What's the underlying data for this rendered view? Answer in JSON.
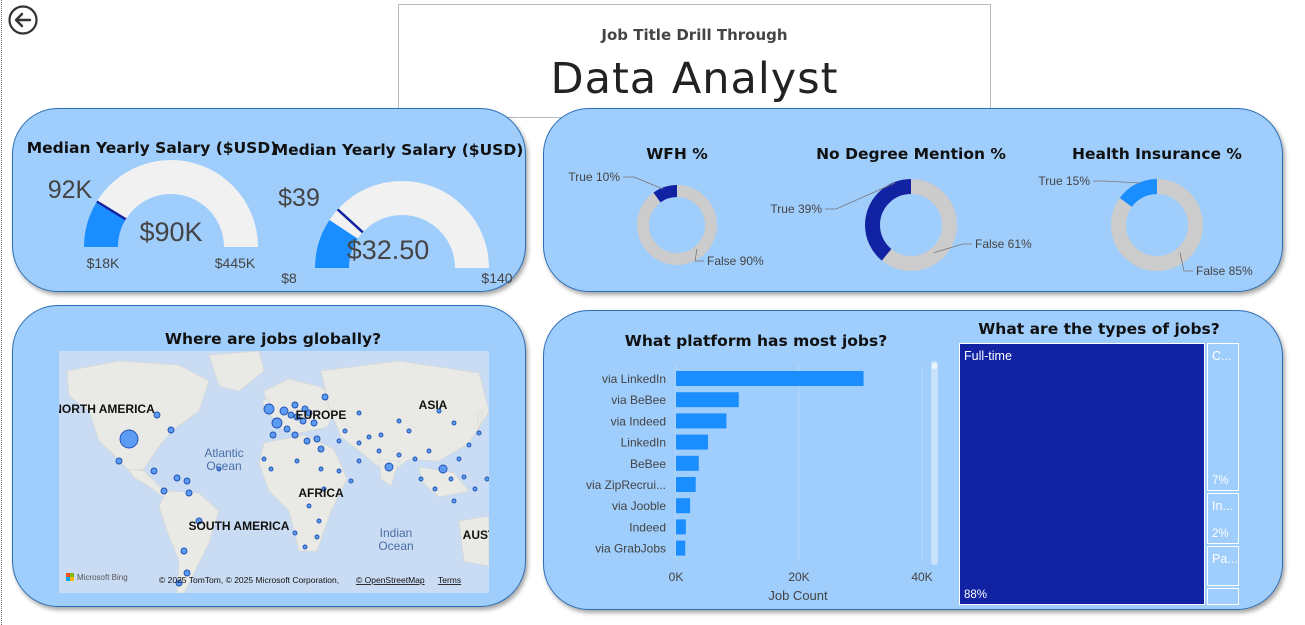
{
  "header": {
    "subtitle": "Job Title Drill Through",
    "title": "Data Analyst"
  },
  "salary_gauges": [
    {
      "title": "Median Yearly Salary ($USD)",
      "value": "$90K",
      "target": "92K",
      "min": "$18K",
      "max": "$445K",
      "fill_fraction": 0.17,
      "target_fraction": 0.175
    },
    {
      "title": "Median Yearly Salary ($USD)",
      "value": "$32.50",
      "target": "$39",
      "min": "$8",
      "max": "$140",
      "fill_fraction": 0.186,
      "target_fraction": 0.235
    }
  ],
  "donuts": [
    {
      "title": "WFH %",
      "true_label": "True 10%",
      "false_label": "False 90%",
      "true_fraction": 0.1,
      "true_color": "#1123a3"
    },
    {
      "title": "No Degree Mention %",
      "true_label": "True 39%",
      "false_label": "False 61%",
      "true_fraction": 0.39,
      "true_color": "#1123a3"
    },
    {
      "title": "Health Insurance %",
      "true_label": "True 15%",
      "false_label": "False 85%",
      "true_fraction": 0.15,
      "true_color": "#1a8dff"
    }
  ],
  "map": {
    "title": "Where are jobs globally?",
    "labels": {
      "north_america": "NORTH AMERICA",
      "europe": "EUROPE",
      "asia": "ASIA",
      "atlantic": "Atlantic",
      "ocean1": "Ocean",
      "africa": "AFRICA",
      "south_america": "SOUTH AMERICA",
      "indian": "Indian",
      "ocean2": "Ocean",
      "aust": "AUST"
    },
    "bing": "Microsoft Bing",
    "attribution": "© 2025 TomTom, © 2025 Microsoft Corporation,",
    "osm": "© OpenStreetMap",
    "terms": "Terms"
  },
  "platform_chart": {
    "title": "What platform has most jobs?",
    "xlabel": "Job Count",
    "ticks": [
      "0K",
      "20K",
      "40K"
    ]
  },
  "chart_data": {
    "type": "bar",
    "title": "What platform has most jobs?",
    "xlabel": "Job Count",
    "ylabel": "",
    "xlim": [
      0,
      40000
    ],
    "categories": [
      "via LinkedIn",
      "via BeBee",
      "via Indeed",
      "LinkedIn",
      "BeBee",
      "via ZipRecrui...",
      "via Jooble",
      "Indeed",
      "via GrabJobs"
    ],
    "values": [
      30500,
      10200,
      8200,
      5200,
      3700,
      3200,
      2300,
      1600,
      1500
    ],
    "color": "#1a8dff"
  },
  "job_types": {
    "title": "What are the types of jobs?",
    "items": [
      {
        "label": "Full-time",
        "pct": "88%",
        "color": "#1123a3"
      },
      {
        "label": "C...",
        "pct": "7%",
        "color": "#9fcdfc"
      },
      {
        "label": "In...",
        "pct": "2%",
        "color": "#9fcdfc"
      },
      {
        "label": "Pa...",
        "pct": "",
        "color": "#9fcdfc"
      },
      {
        "label": "",
        "pct": "",
        "color": "#9fcdfc"
      }
    ]
  }
}
